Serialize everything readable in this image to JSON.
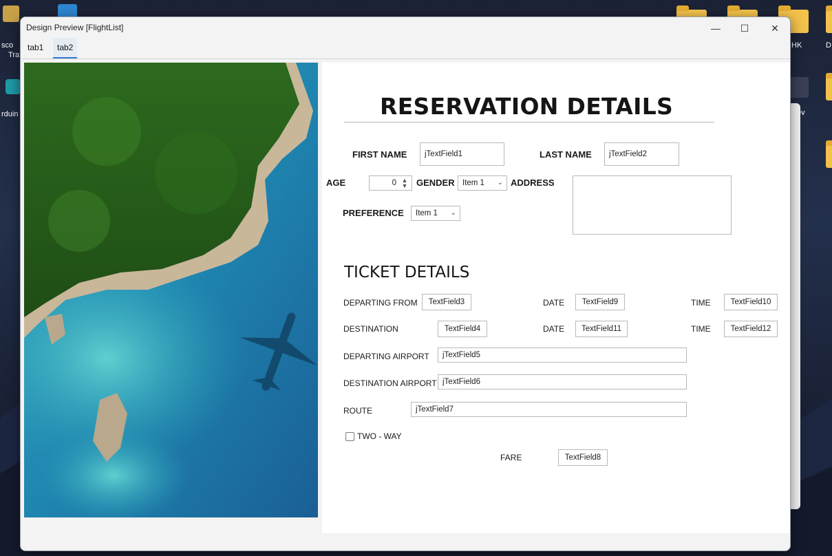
{
  "desktop": {
    "left_label_1": "sco",
    "left_label_2": "Tra",
    "left_label_3": "rduin",
    "right_label_1": "HK",
    "right_label_2": "D",
    "right_label_3": "ev"
  },
  "window": {
    "title": "Design Preview [FlightList]",
    "minimize_glyph": "—",
    "maximize_glyph": "☐",
    "close_glyph": "✕"
  },
  "tabs": [
    {
      "label": "tab1",
      "active": false
    },
    {
      "label": "tab2",
      "active": true
    }
  ],
  "reservation": {
    "heading": "RESERVATION DETAILS",
    "first_name_label": "FIRST NAME",
    "first_name_value": "jTextField1",
    "last_name_label": "LAST NAME",
    "last_name_value": "jTextField2",
    "age_label": "AGE",
    "age_value": "0",
    "gender_label": "GENDER",
    "gender_value": "Item 1",
    "address_label": "ADDRESS",
    "address_value": "",
    "preference_label": "PREFERENCE",
    "preference_value": "Item 1"
  },
  "ticket": {
    "heading": "TICKET DETAILS",
    "departing_from_label": "DEPARTING FROM",
    "departing_from_value": "TextField3",
    "date1_label": "DATE",
    "date1_value": "TextField9",
    "time1_label": "TIME",
    "time1_value": "TextField10",
    "destination_label": "DESTINATION",
    "destination_value": "TextField4",
    "date2_label": "DATE",
    "date2_value": "TextField11",
    "time2_label": "TIME",
    "time2_value": "TextField12",
    "departing_airport_label": "DEPARTING AIRPORT",
    "departing_airport_value": "jTextField5",
    "destination_airport_label": "DESTINATION AIRPORT",
    "destination_airport_value": "jTextField6",
    "route_label": "ROUTE",
    "route_value": "jTextField7",
    "two_way_label": "TWO - WAY",
    "two_way_checked": false,
    "fare_label": "FARE",
    "fare_value": "TextField8"
  },
  "icons": {
    "spinner": "up-down-spinner-icon",
    "dropdown": "chevron-down-icon"
  },
  "colors": {
    "tab_underline": "#2f7ad8",
    "panel_background": "#ffffff",
    "window_background": "#f3f3f3"
  }
}
